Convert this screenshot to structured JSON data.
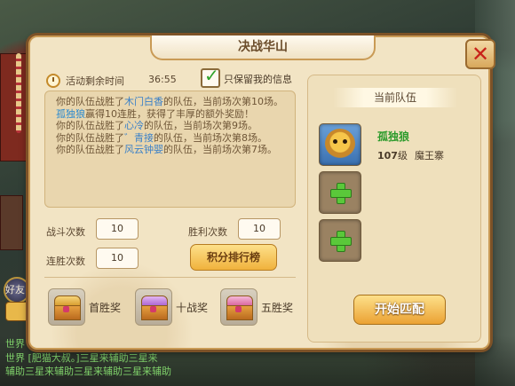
{
  "title": "决战华山",
  "timer": {
    "label": "活动剩余时间",
    "value": "36:55"
  },
  "only_mine": {
    "label": "只保留我的信息",
    "checked": true
  },
  "log": [
    {
      "pre": "你的队伍战胜了",
      "name": "木门白香",
      "post": "的队伍，当前场次第10场。"
    },
    {
      "pre": "",
      "name": "孤独狼",
      "post": "赢得10连胜，获得了丰厚的额外奖励！"
    },
    {
      "pre": "你的队伍战胜了",
      "name": "心冷",
      "post": "的队伍，当前场次第9场。"
    },
    {
      "pre": "你的队伍战胜了",
      "name": "゛青接",
      "post": "的队伍，当前场次第8场。"
    },
    {
      "pre": "你的队伍战胜了",
      "name": "风云钟婴",
      "post": "的队伍，当前场次第7场。"
    }
  ],
  "stats": {
    "battles_label": "战斗次数",
    "battles": "10",
    "wins_label": "胜利次数",
    "wins": "10",
    "streak_label": "连胜次数",
    "streak": "10"
  },
  "rank_button": "积分排行榜",
  "rewards": [
    {
      "label": "首胜奖"
    },
    {
      "label": "十战奖"
    },
    {
      "label": "五胜奖"
    }
  ],
  "team": {
    "title": "当前队伍",
    "member": {
      "name": "孤独狼",
      "level": "107",
      "level_suffix": "级",
      "faction": "魔王寨"
    }
  },
  "match_button": "开始匹配",
  "friend_label": "好友",
  "chat": [
    "世界 [肥猫大叔。]三星来辅助三星来",
    "辅助三星来辅助三星来辅助三星来辅助",
    "世界"
  ],
  "colors": {
    "accent": "#f0b23c",
    "name_highlight": "#3a80c8",
    "member_name": "#2a9a2a",
    "close": "#c8221a"
  }
}
